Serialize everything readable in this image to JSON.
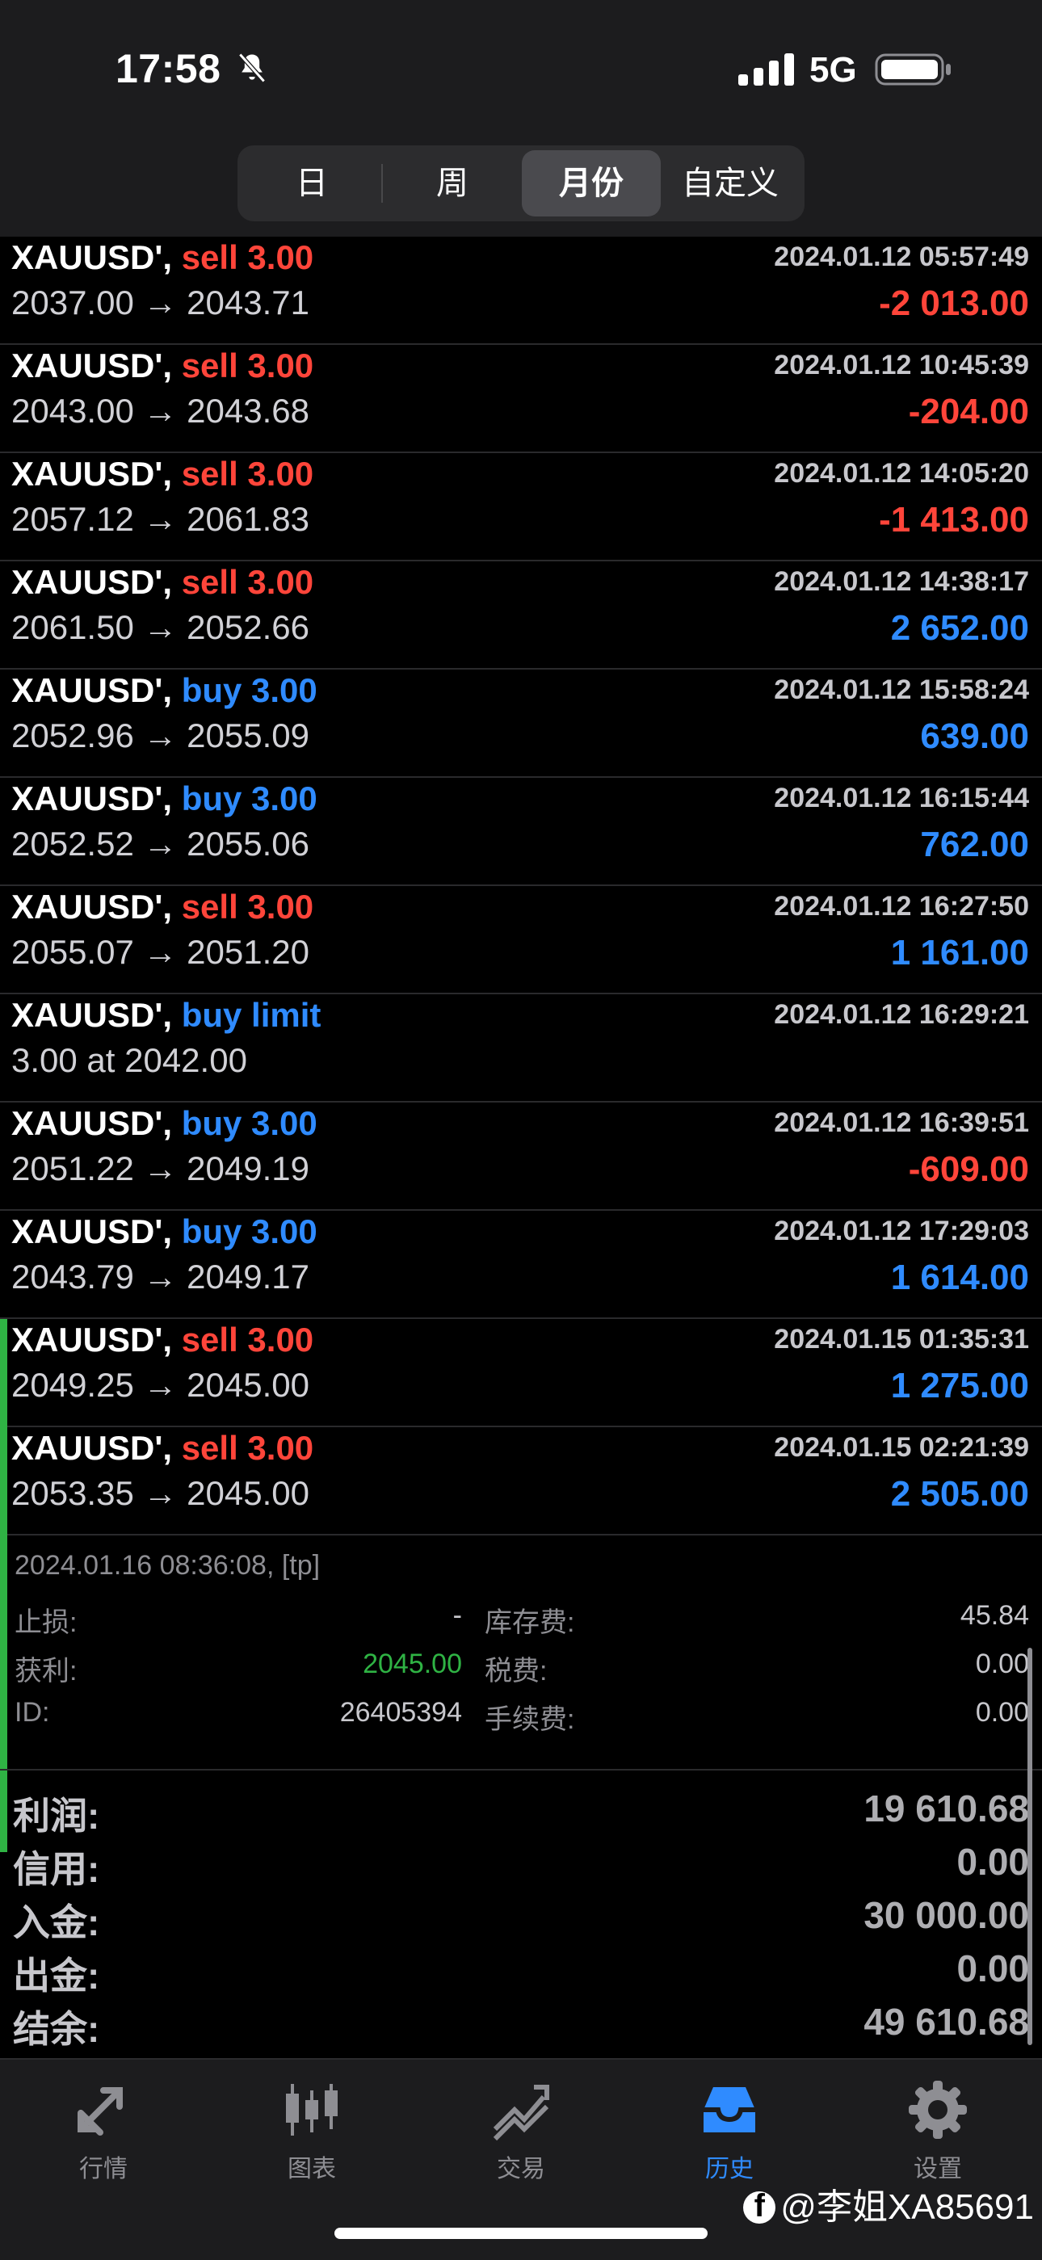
{
  "status_bar": {
    "time": "17:58",
    "network": "5G",
    "icons": [
      "bell-slash-icon",
      "signal-icon",
      "battery-icon"
    ]
  },
  "period_tabs": {
    "items": [
      "日",
      "周",
      "月份",
      "自定义"
    ],
    "active": "月份"
  },
  "trades": [
    {
      "symbol": "XAUUSD',",
      "side": "sell 3.00",
      "side_type": "sell",
      "datetime": "2024.01.12 05:57:49",
      "prices": "2037.00 → 2043.71",
      "profit": "-2 013.00",
      "profit_sign": "neg"
    },
    {
      "symbol": "XAUUSD',",
      "side": "sell 3.00",
      "side_type": "sell",
      "datetime": "2024.01.12 10:45:39",
      "prices": "2043.00 → 2043.68",
      "profit": "-204.00",
      "profit_sign": "neg"
    },
    {
      "symbol": "XAUUSD',",
      "side": "sell 3.00",
      "side_type": "sell",
      "datetime": "2024.01.12 14:05:20",
      "prices": "2057.12 → 2061.83",
      "profit": "-1 413.00",
      "profit_sign": "neg"
    },
    {
      "symbol": "XAUUSD',",
      "side": "sell 3.00",
      "side_type": "sell",
      "datetime": "2024.01.12 14:38:17",
      "prices": "2061.50 → 2052.66",
      "profit": "2 652.00",
      "profit_sign": "pos"
    },
    {
      "symbol": "XAUUSD',",
      "side": "buy 3.00",
      "side_type": "buy",
      "datetime": "2024.01.12 15:58:24",
      "prices": "2052.96 → 2055.09",
      "profit": "639.00",
      "profit_sign": "pos"
    },
    {
      "symbol": "XAUUSD',",
      "side": "buy 3.00",
      "side_type": "buy",
      "datetime": "2024.01.12 16:15:44",
      "prices": "2052.52 → 2055.06",
      "profit": "762.00",
      "profit_sign": "pos"
    },
    {
      "symbol": "XAUUSD',",
      "side": "sell 3.00",
      "side_type": "sell",
      "datetime": "2024.01.12 16:27:50",
      "prices": "2055.07 → 2051.20",
      "profit": "1 161.00",
      "profit_sign": "pos"
    },
    {
      "symbol": "XAUUSD',",
      "side": "buy limit",
      "side_type": "buy",
      "datetime": "2024.01.12 16:29:21",
      "prices": "3.00 at 2042.00",
      "profit": "",
      "profit_sign": "pos"
    },
    {
      "symbol": "XAUUSD',",
      "side": "buy 3.00",
      "side_type": "buy",
      "datetime": "2024.01.12 16:39:51",
      "prices": "2051.22 → 2049.19",
      "profit": "-609.00",
      "profit_sign": "neg"
    },
    {
      "symbol": "XAUUSD',",
      "side": "buy 3.00",
      "side_type": "buy",
      "datetime": "2024.01.12 17:29:03",
      "prices": "2043.79 → 2049.17",
      "profit": "1 614.00",
      "profit_sign": "pos"
    },
    {
      "symbol": "XAUUSD',",
      "side": "sell 3.00",
      "side_type": "sell",
      "datetime": "2024.01.15 01:35:31",
      "prices": "2049.25 → 2045.00",
      "profit": "1 275.00",
      "profit_sign": "pos",
      "marked": true
    },
    {
      "symbol": "XAUUSD',",
      "side": "sell 3.00",
      "side_type": "sell",
      "datetime": "2024.01.15 02:21:39",
      "prices": "2053.35 → 2045.00",
      "profit": "2 505.00",
      "profit_sign": "pos",
      "marked": true
    }
  ],
  "details": {
    "close_info": "2024.01.16 08:36:08, [tp]",
    "stop_loss_label": "止损:",
    "stop_loss_value": "-",
    "take_profit_label": "获利:",
    "take_profit_value": "2045.00",
    "id_label": "ID:",
    "id_value": "26405394",
    "swap_label": "库存费:",
    "swap_value": "45.84",
    "tax_label": "税费:",
    "tax_value": "0.00",
    "commission_label": "手续费:",
    "commission_value": "0.00"
  },
  "summary": [
    {
      "label": "利润:",
      "value": "19 610.68"
    },
    {
      "label": "信用:",
      "value": "0.00"
    },
    {
      "label": "入金:",
      "value": "30 000.00"
    },
    {
      "label": "出金:",
      "value": "0.00"
    },
    {
      "label": "结余:",
      "value": "49 610.68"
    }
  ],
  "tabbar": {
    "items": [
      {
        "label": "行情",
        "icon": "quotes-icon"
      },
      {
        "label": "图表",
        "icon": "candlestick-icon"
      },
      {
        "label": "交易",
        "icon": "trade-icon"
      },
      {
        "label": "历史",
        "icon": "history-inbox-icon"
      },
      {
        "label": "设置",
        "icon": "gear-icon"
      }
    ],
    "active": "历史"
  },
  "watermark": "@李姐XA85691",
  "colors": {
    "sell": "#ff453a",
    "buy": "#2f8bff",
    "loss": "#ff453a",
    "gain": "#2f8bff",
    "take_profit": "#2fb344",
    "active_tab": "#2f8bff"
  }
}
